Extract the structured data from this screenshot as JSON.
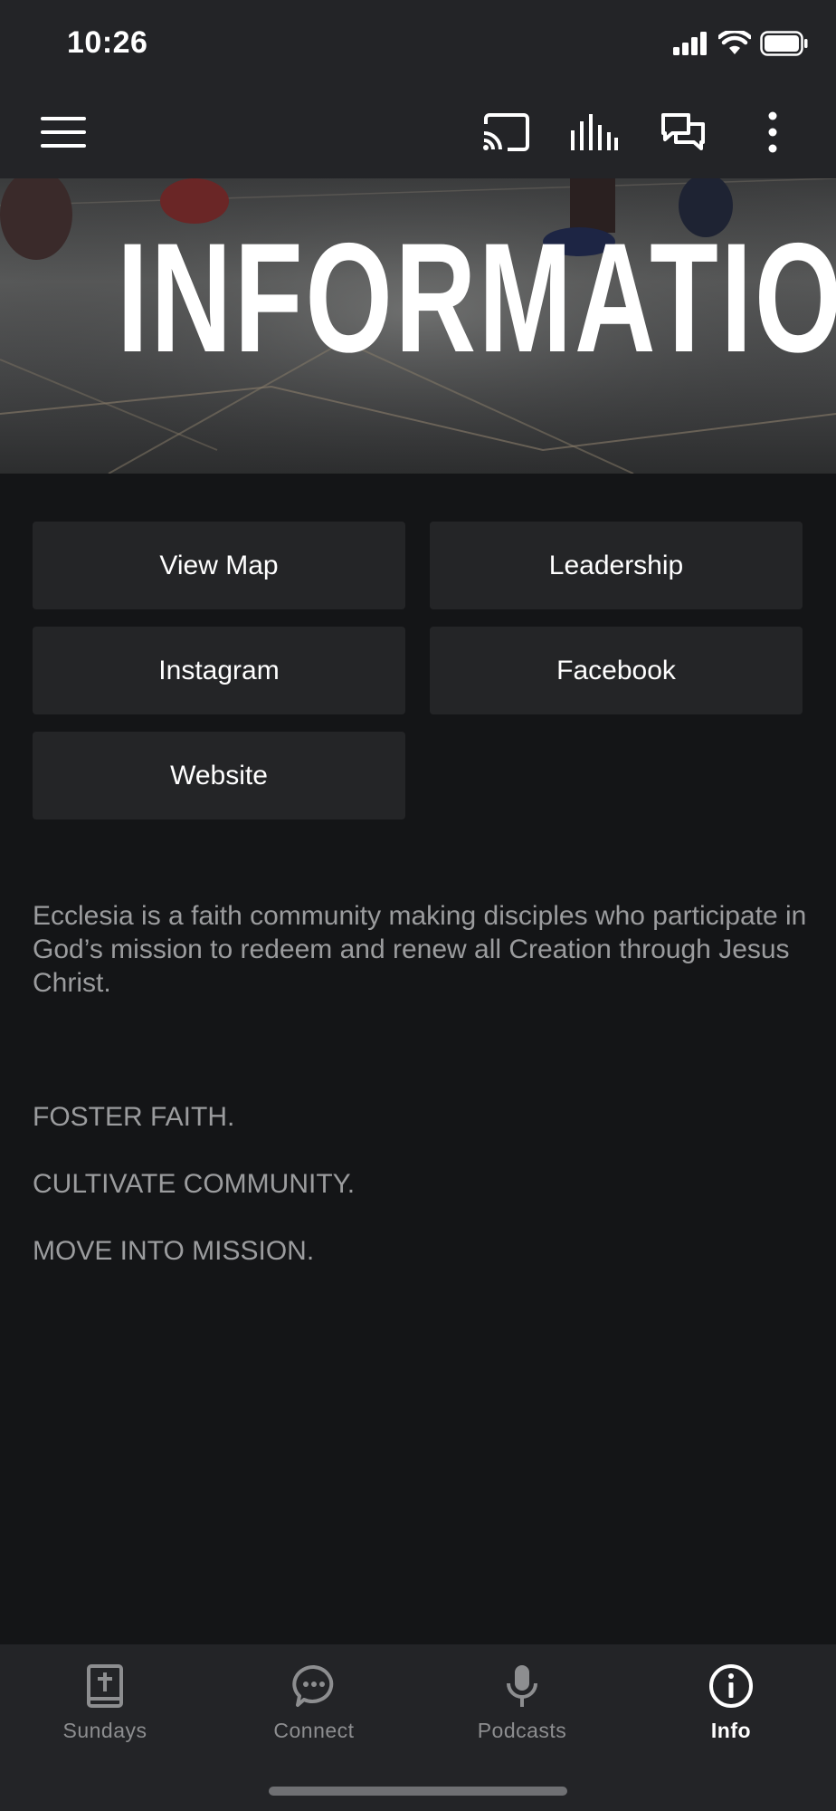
{
  "status_bar": {
    "time": "10:26"
  },
  "app_bar": {
    "icons": [
      "menu-icon",
      "cast-icon",
      "audio-bars-icon",
      "chat-icon",
      "more-vert-icon"
    ]
  },
  "hero": {
    "title": "INFORMATION"
  },
  "buttons": {
    "view_map": "View Map",
    "leadership": "Leadership",
    "instagram": "Instagram",
    "facebook": "Facebook",
    "website": "Website"
  },
  "description": {
    "paragraph": "Ecclesia is a faith community making disciples who participate in God’s mission to redeem and renew all Creation through Jesus Christ.",
    "line1": "FOSTER FAITH.",
    "line2": "CULTIVATE COMMUNITY.",
    "line3": "MOVE INTO MISSION."
  },
  "bottom_nav": {
    "items": [
      {
        "label": "Sundays",
        "icon": "bible-icon",
        "active": false
      },
      {
        "label": "Connect",
        "icon": "chat-bubble-icon",
        "active": false
      },
      {
        "label": "Podcasts",
        "icon": "microphone-icon",
        "active": false
      },
      {
        "label": "Info",
        "icon": "info-icon",
        "active": true
      }
    ]
  },
  "colors": {
    "background": "#141517",
    "bar": "#232427",
    "button": "#242527",
    "muted_text": "#9b9c9e",
    "inactive_nav": "#8d8e90"
  }
}
